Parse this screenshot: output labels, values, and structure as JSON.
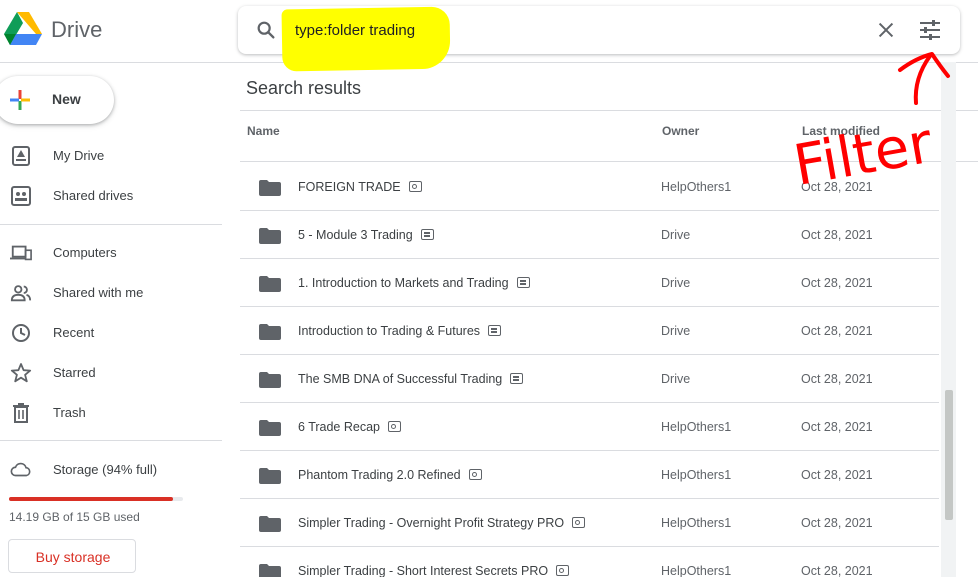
{
  "app": {
    "brand": "Drive"
  },
  "search": {
    "query": "type:folder trading"
  },
  "sidebar": {
    "new_label": "New",
    "items": [
      {
        "label": "My Drive",
        "icon": "my-drive-icon"
      },
      {
        "label": "Shared drives",
        "icon": "shared-drives-icon"
      },
      {
        "label": "Computers",
        "icon": "computers-icon"
      },
      {
        "label": "Shared with me",
        "icon": "shared-with-me-icon"
      },
      {
        "label": "Recent",
        "icon": "clock-icon"
      },
      {
        "label": "Starred",
        "icon": "star-icon"
      },
      {
        "label": "Trash",
        "icon": "trash-icon"
      }
    ],
    "storage": {
      "label": "Storage (94% full)",
      "used_text": "14.19 GB of 15 GB used",
      "fraction_used": 0.94,
      "bar_color": "#d93025"
    },
    "buy_label": "Buy storage"
  },
  "main": {
    "title": "Search results",
    "columns": {
      "name": "Name",
      "owner": "Owner",
      "modified": "Last modified"
    },
    "rows": [
      {
        "name": "FOREIGN TRADE",
        "badge": "key",
        "owner": "HelpOthers1",
        "modified": "Oct 28, 2021"
      },
      {
        "name": "5 - Module 3 Trading",
        "badge": "shared",
        "owner": "Drive",
        "modified": "Oct 28, 2021"
      },
      {
        "name": "1. Introduction to Markets and Trading",
        "badge": "shared",
        "owner": "Drive",
        "modified": "Oct 28, 2021"
      },
      {
        "name": "Introduction to Trading & Futures",
        "badge": "shared",
        "owner": "Drive",
        "modified": "Oct 28, 2021"
      },
      {
        "name": "The SMB DNA of Successful Trading",
        "badge": "shared",
        "owner": "Drive",
        "modified": "Oct 28, 2021"
      },
      {
        "name": "6 Trade Recap",
        "badge": "key",
        "owner": "HelpOthers1",
        "modified": "Oct 28, 2021"
      },
      {
        "name": "Phantom Trading 2.0 Refined",
        "badge": "key",
        "owner": "HelpOthers1",
        "modified": "Oct 28, 2021"
      },
      {
        "name": "Simpler Trading - Overnight Profit Strategy PRO",
        "badge": "key",
        "owner": "HelpOthers1",
        "modified": "Oct 28, 2021"
      },
      {
        "name": "Simpler Trading - Short Interest Secrets PRO",
        "badge": "key",
        "owner": "HelpOthers1",
        "modified": "Oct 28, 2021"
      }
    ]
  },
  "annotation": {
    "text": "Filter",
    "color": "#ff0000"
  },
  "colors": {
    "accent_red": "#d93025",
    "highlight": "#ffff00",
    "icon_gray": "#5f6368"
  }
}
